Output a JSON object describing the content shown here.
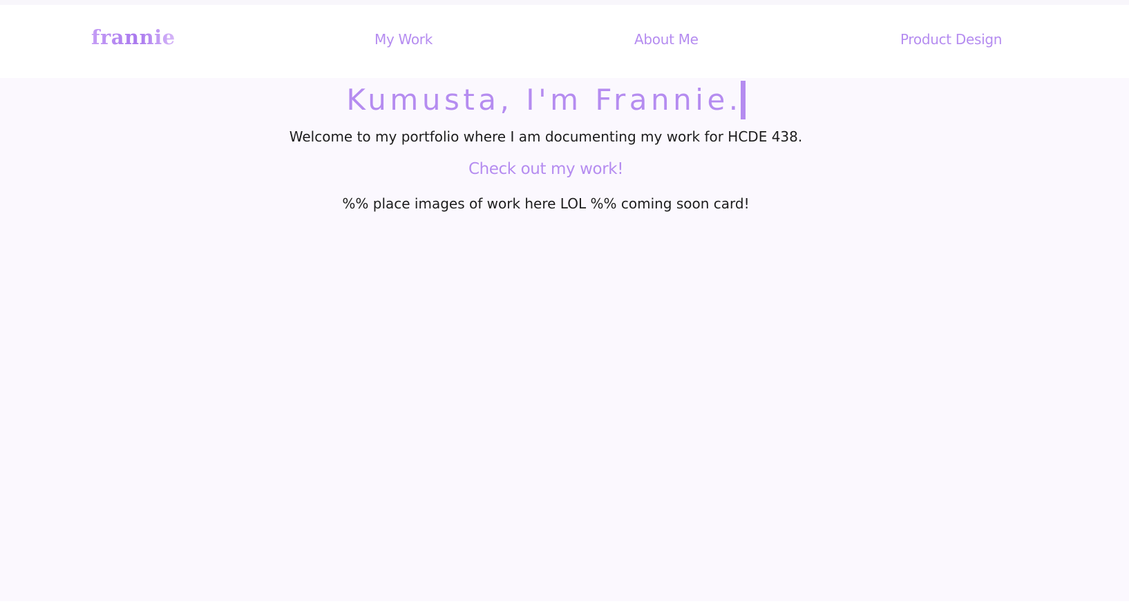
{
  "header": {
    "logo_text": "frannie",
    "nav": [
      {
        "label": "My Work"
      },
      {
        "label": "About Me"
      },
      {
        "label": "Product Design"
      }
    ]
  },
  "hero": {
    "title": "Kumusta, I'm Frannie.",
    "welcome": "Welcome to my portfolio where I am documenting my work for HCDE 438.",
    "cta_label": "Check out my work!",
    "placeholder_note": "%% place images of work here LOL %% coming soon card!"
  },
  "colors": {
    "accent": "#b58cf0",
    "page_background": "#fbf8fe",
    "nav_background": "#ffffff",
    "body_text": "#1d1d1d"
  }
}
